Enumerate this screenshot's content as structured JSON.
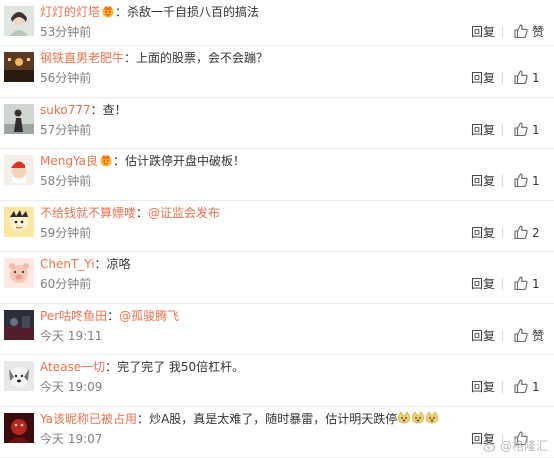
{
  "comments": [
    {
      "user": "灯灯的灯塔",
      "badge": true,
      "text": "杀敌一千自损八百的搞法",
      "mention": "",
      "emoji_count": 0,
      "time": "53分钟前",
      "reply": "回复",
      "likes": "赞",
      "avatar_icon": "avatar-girl-icon"
    },
    {
      "user": "钢铁直男老肥牛",
      "badge": false,
      "text": "上面的股票，会不会蹦？",
      "mention": "",
      "emoji_count": 0,
      "time": "56分钟前",
      "reply": "回复",
      "likes": "1",
      "avatar_icon": "avatar-room-icon"
    },
    {
      "user": "suko777",
      "badge": false,
      "text": "查！",
      "mention": "",
      "emoji_count": 0,
      "time": "57分钟前",
      "reply": "回复",
      "likes": "1",
      "avatar_icon": "avatar-person-icon"
    },
    {
      "user": "MengYa良",
      "badge": true,
      "text": "估计跌停开盘中破板！",
      "mention": "",
      "emoji_count": 0,
      "time": "58分钟前",
      "reply": "回复",
      "likes": "1",
      "avatar_icon": "avatar-santa-icon"
    },
    {
      "user": "不给钱就不算嫖喽",
      "badge": false,
      "text": "",
      "mention": "@证监会发布",
      "emoji_count": 0,
      "time": "59分钟前",
      "reply": "回复",
      "likes": "2",
      "avatar_icon": "avatar-cartoon-icon"
    },
    {
      "user": "ChenT_Yi",
      "badge": false,
      "text": "凉咯",
      "mention": "",
      "emoji_count": 0,
      "time": "60分钟前",
      "reply": "回复",
      "likes": "1",
      "avatar_icon": "avatar-pig-icon"
    },
    {
      "user": "Per咕咚鱼田",
      "badge": false,
      "text": "",
      "mention": "@孤骏腾飞",
      "emoji_count": 0,
      "time": "今天 19:11",
      "reply": "回复",
      "likes": "赞",
      "avatar_icon": "avatar-dark-icon"
    },
    {
      "user": "Atease一切",
      "badge": false,
      "text": "完了完了 我50倍杠杆。",
      "mention": "",
      "emoji_count": 0,
      "time": "今天 19:09",
      "reply": "回复",
      "likes": "1",
      "avatar_icon": "avatar-dog-icon"
    },
    {
      "user": "Ya该昵称已被占用",
      "badge": false,
      "text": "炒A股，真是太难了，随时暴雷，估计明天跌停",
      "mention": "",
      "emoji_count": 3,
      "time": "今天 19:07",
      "reply": "回复",
      "likes": "",
      "avatar_icon": "avatar-red-icon"
    }
  ],
  "colors": {
    "username": "#eb7350",
    "time": "#808080"
  },
  "watermark": "@格隆汇"
}
